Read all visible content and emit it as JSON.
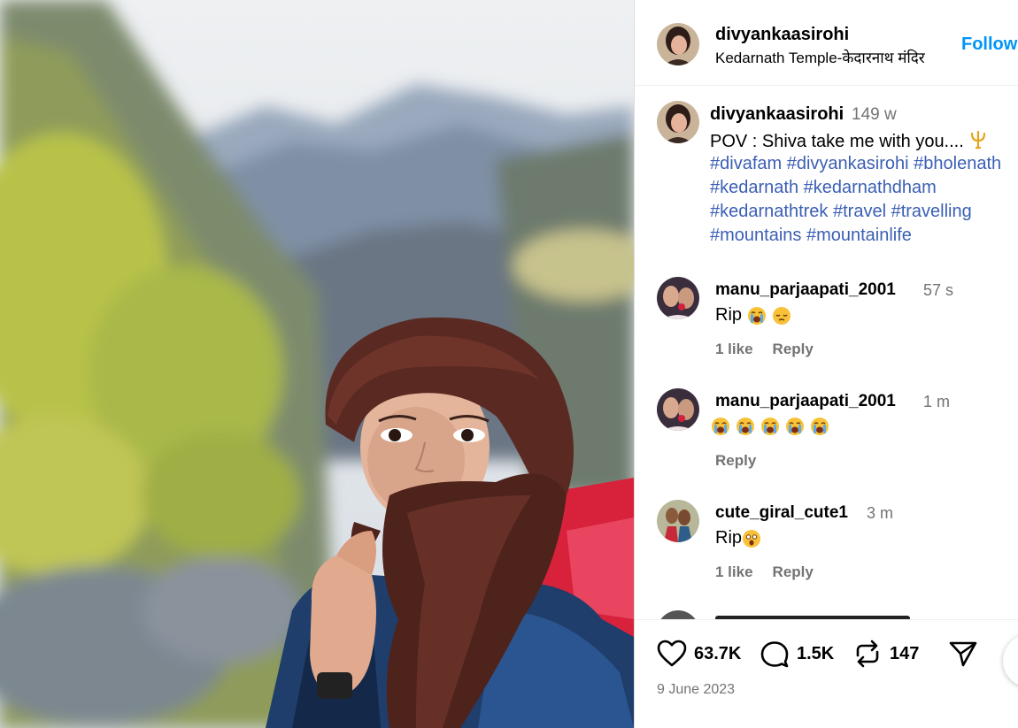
{
  "post": {
    "author": "divyankaasirohi",
    "location": "Kedarnath Temple-केदारनाथ मंदिर",
    "follow_label": "Follow",
    "caption": {
      "author": "divyankaasirohi",
      "age": "149 w",
      "text": "POV : Shiva take me with you....",
      "hashtag_lines": [
        [
          "#divafam",
          "#divyankasirohi",
          "#bholenath"
        ],
        [
          "#kedarnath",
          "#kedarnathdham"
        ],
        [
          "#kedarnathtrek",
          "#travel",
          "#travelling"
        ],
        [
          "#mountains",
          "#mountainlife"
        ]
      ]
    },
    "comments": [
      {
        "user": "manu_parjaapati_2001",
        "age": "57 s",
        "text": "Rip",
        "likes": "1 like",
        "reply_label": "Reply"
      },
      {
        "user": "manu_parjaapati_2001",
        "age": "1 m",
        "text": "",
        "likes": "",
        "reply_label": "Reply"
      },
      {
        "user": "cute_giral_cute1",
        "age": "3 m",
        "text": "Rip",
        "likes": "1 like",
        "reply_label": "Reply"
      }
    ],
    "stats": {
      "likes": "63.7K",
      "comments": "1.5K",
      "reposts": "147"
    },
    "date": "9 June 2023"
  },
  "icons": [
    "heart-icon",
    "comment-icon",
    "repost-icon",
    "share-icon",
    "trident-emoji",
    "crying-emoji",
    "sad-emoji",
    "shocked-emoji"
  ],
  "colors": {
    "follow": "#0095f6",
    "hashtag": "#3b5fb4",
    "muted": "#737373"
  }
}
